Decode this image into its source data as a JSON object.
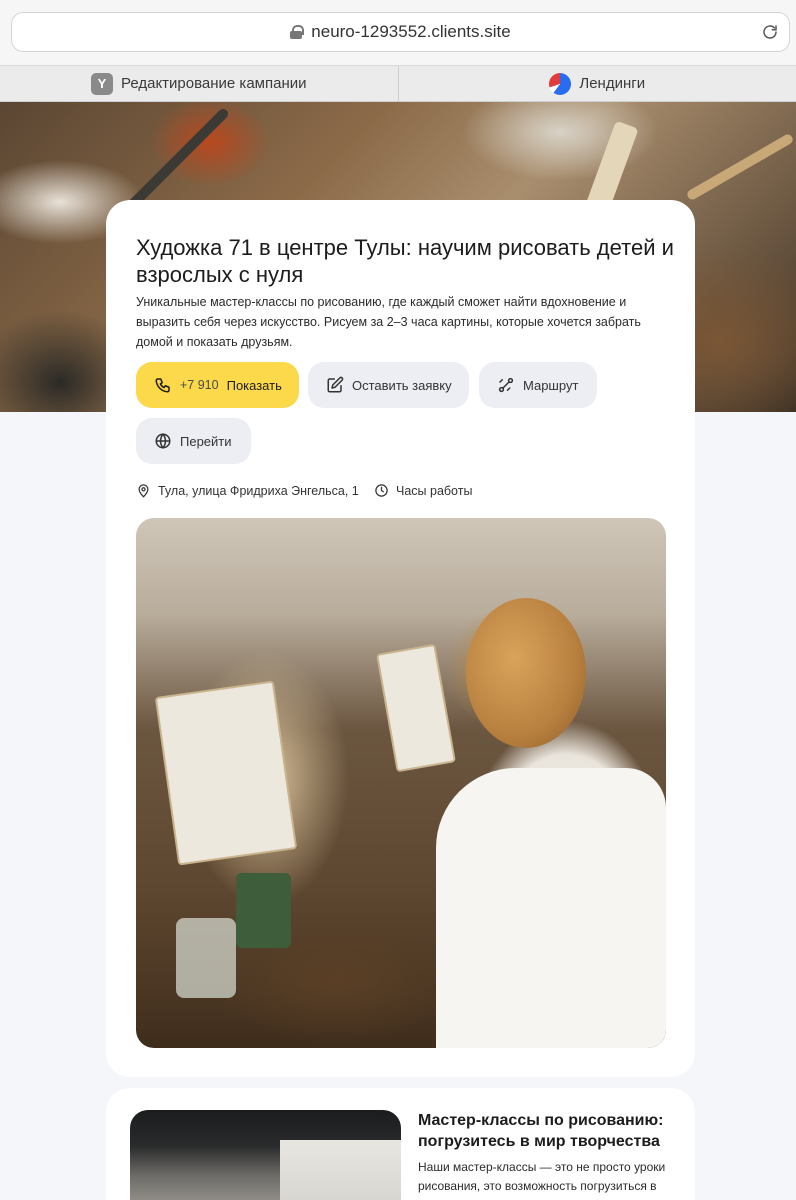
{
  "browser": {
    "url": "neuro-1293552.clients.site",
    "tabs": [
      {
        "label": "Редактирование кампании",
        "icon": "yandex-y-icon"
      },
      {
        "label": "Лендинги",
        "icon": "landings-logo-icon"
      }
    ]
  },
  "hero": {
    "title": "Художка 71 в центре Тулы: научим рисовать детей и взрослых с нуля",
    "description": "Уникальные мастер-классы по рисованию, где каждый сможет найти вдохновение и выразить себя через искусство. Рисуем за 2–3 часа картины, которые хочется забрать домой и показать друзьям.",
    "buttons": {
      "phone_number": "+7 910",
      "phone_show": "Показать",
      "apply": "Оставить заявку",
      "route": "Маршрут",
      "go": "Перейти"
    },
    "address": "Тула, улица Фридриха Энгельса, 1",
    "hours": "Часы работы"
  },
  "section2": {
    "title": "Мастер-классы по рисованию: погрузитесь в мир творчества",
    "text": "Наши мастер-классы — это не просто уроки рисования, это возможность погрузиться в атмосферу творчества, расслабиться и"
  },
  "colors": {
    "accent_yellow": "#fbd94a",
    "button_gray": "#eceef3",
    "page_bg": "#f4f6f9"
  }
}
